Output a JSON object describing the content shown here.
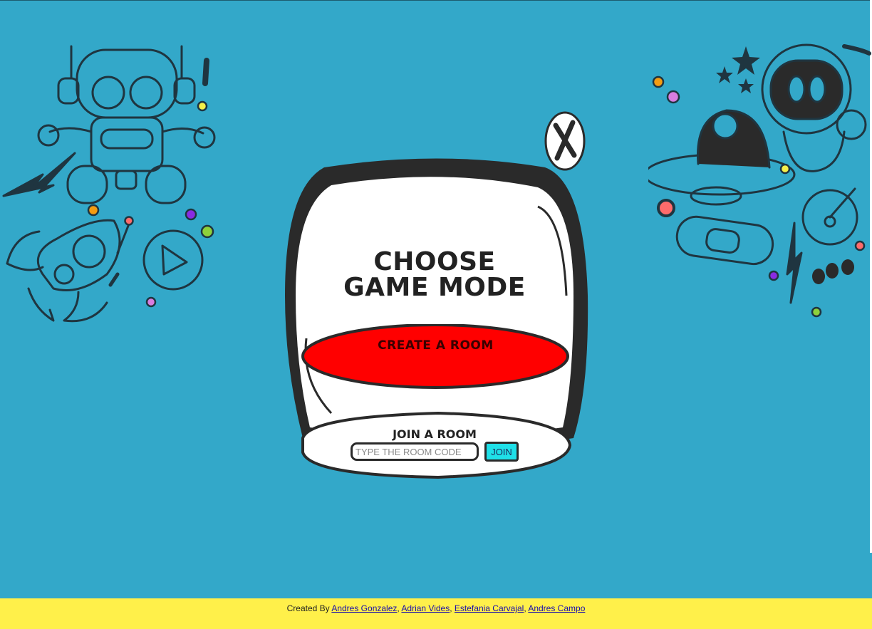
{
  "modal": {
    "title_line1": "CHOOSE",
    "title_line2": "GAME MODE",
    "create_label": "CREATE A ROOM",
    "join_title": "JOIN A ROOM",
    "room_input_placeholder": "TYPE THE ROOM CODE",
    "room_input_value": "",
    "join_label": "JOIN",
    "close_label": "X"
  },
  "footer": {
    "prefix": "Created By",
    "authors": [
      "Andres Gonzalez",
      "Adrian Vides",
      "Estefania Carvajal",
      "Andres Campo"
    ],
    "separator": ","
  },
  "colors": {
    "background": "#33a8c9",
    "footer": "#fff04a",
    "create_button": "#ff0000",
    "join_button": "#1fe0e8",
    "outline": "#2a2a2a"
  },
  "icons": {
    "left_doodles": [
      "robot-icon",
      "rocket-icon",
      "play-icon",
      "lightning-icon"
    ],
    "right_doodles": [
      "astronaut-icon",
      "ufo-icon",
      "star-icon",
      "lightning-icon"
    ],
    "close": "close-icon"
  }
}
